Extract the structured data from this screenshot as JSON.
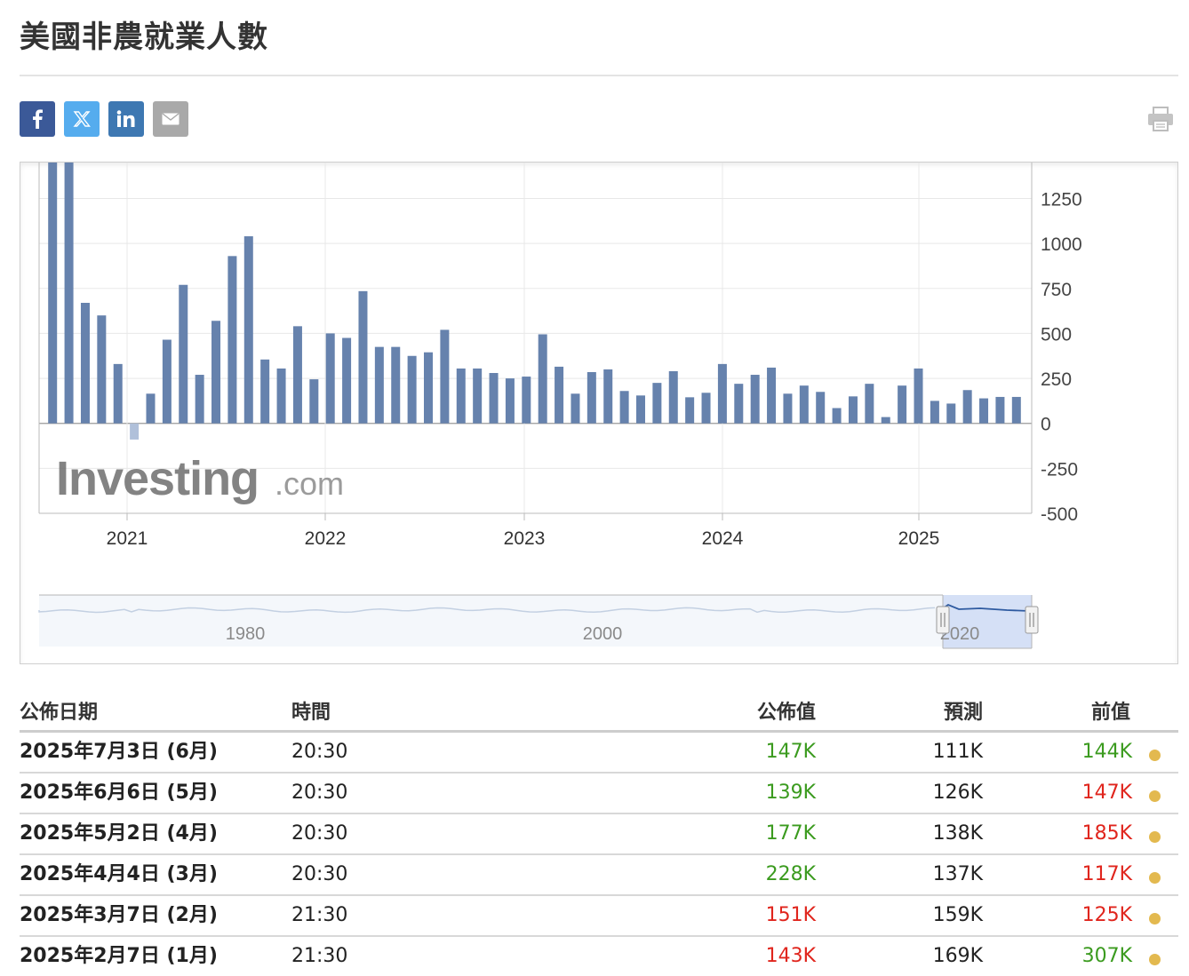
{
  "page": {
    "title": "美國非農就業人數"
  },
  "share": {
    "facebook_icon": "facebook-icon",
    "twitter_icon": "x-twitter-icon",
    "linkedin_icon": "linkedin-icon",
    "email_icon": "envelope-icon",
    "print_icon": "printer-icon"
  },
  "chart_data": {
    "type": "bar",
    "bar_color": "#6682ad",
    "negative_bar_color": "#b0c0da",
    "values": [
      1450,
      1450,
      670,
      600,
      330,
      -90,
      165,
      465,
      770,
      270,
      570,
      930,
      1040,
      355,
      305,
      540,
      245,
      500,
      475,
      735,
      425,
      425,
      375,
      395,
      520,
      305,
      305,
      280,
      250,
      260,
      495,
      315,
      165,
      285,
      300,
      180,
      155,
      225,
      290,
      145,
      170,
      330,
      220,
      270,
      310,
      165,
      210,
      175,
      85,
      150,
      220,
      35,
      210,
      305,
      125,
      110,
      185,
      139,
      147,
      147
    ],
    "ylim": [
      -500,
      1450
    ],
    "yticks": [
      -500,
      -250,
      0,
      250,
      500,
      750,
      1000,
      1250
    ],
    "year_labels": [
      "2021",
      "2022",
      "2023",
      "2024",
      "2025"
    ],
    "watermark": {
      "main": "Investing",
      "suffix": ".com"
    },
    "navigator": {
      "labels": [
        "1980",
        "2000",
        "2020"
      ]
    },
    "grid": true
  },
  "table": {
    "headers": {
      "date": "公佈日期",
      "time": "時間",
      "actual": "公佈值",
      "forecast": "預測",
      "previous": "前值"
    },
    "rows": [
      {
        "date": "2025年7月3日 (6月)",
        "time": "20:30",
        "actual": "147K",
        "actual_color": "green",
        "forecast": "111K",
        "previous": "144K",
        "previous_color": "green"
      },
      {
        "date": "2025年6月6日 (5月)",
        "time": "20:30",
        "actual": "139K",
        "actual_color": "green",
        "forecast": "126K",
        "previous": "147K",
        "previous_color": "red"
      },
      {
        "date": "2025年5月2日 (4月)",
        "time": "20:30",
        "actual": "177K",
        "actual_color": "green",
        "forecast": "138K",
        "previous": "185K",
        "previous_color": "red"
      },
      {
        "date": "2025年4月4日 (3月)",
        "time": "20:30",
        "actual": "228K",
        "actual_color": "green",
        "forecast": "137K",
        "previous": "117K",
        "previous_color": "red"
      },
      {
        "date": "2025年3月7日 (2月)",
        "time": "21:30",
        "actual": "151K",
        "actual_color": "red",
        "forecast": "159K",
        "previous": "125K",
        "previous_color": "red"
      },
      {
        "date": "2025年2月7日 (1月)",
        "time": "21:30",
        "actual": "143K",
        "actual_color": "red",
        "forecast": "169K",
        "previous": "307K",
        "previous_color": "green"
      }
    ]
  }
}
